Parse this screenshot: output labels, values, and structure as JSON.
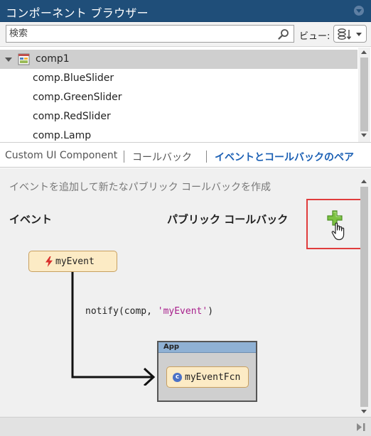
{
  "window": {
    "title": "コンポーネント ブラウザー"
  },
  "search": {
    "placeholder": "検索",
    "value": ""
  },
  "view": {
    "label": "ビュー:"
  },
  "tree": {
    "root": "comp1",
    "items": [
      "comp.BlueSlider",
      "comp.GreenSlider",
      "comp.RedSlider",
      "comp.Lamp"
    ]
  },
  "tabs": [
    {
      "label": "Custom UI Component",
      "active": false
    },
    {
      "label": "コールバック",
      "active": false
    },
    {
      "label": "イベントとコールバックのペア",
      "active": true
    }
  ],
  "panel": {
    "hint": "イベントを追加して新たなパブリック コールバックを作成",
    "event_header": "イベント",
    "callback_header": "パブリック コールバック",
    "event_name": "myEvent",
    "code": {
      "prefix": "notify(comp, ",
      "arg": "'myEvent'",
      "suffix": ")"
    },
    "app_title": "App",
    "callback_name": "myEventFcn",
    "callback_badge": "c"
  },
  "colors": {
    "titlebar": "#1f4e79",
    "active_tab": "#1a5fb4",
    "highlight_border": "#e03c3c",
    "node_fill": "#fcebc5",
    "app_header": "#8fb1d4",
    "string_literal": "#a8208c"
  },
  "icons": [
    "menu-chevron-icon",
    "search-icon",
    "view-options-icon",
    "component-icon",
    "plus-icon",
    "hand-cursor-icon",
    "lightning-icon",
    "callback-c-icon",
    "panel-toggle-icon"
  ]
}
